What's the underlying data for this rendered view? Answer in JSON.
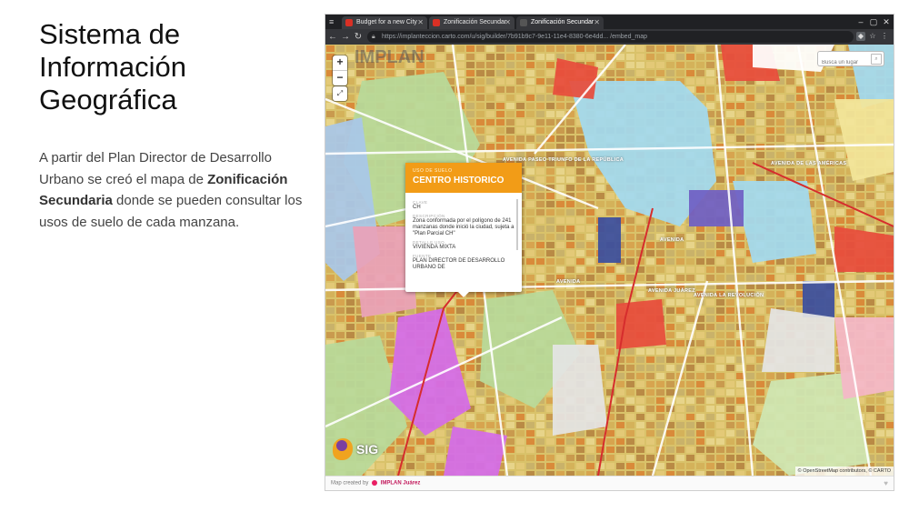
{
  "slide": {
    "title_lines": [
      "Sistema de",
      "Información",
      "Geográfica"
    ],
    "body_part1": "A partir del Plan Director de Desarrollo Urbano se creó el mapa de ",
    "body_bold": "Zonificación Secundaria",
    "body_part2": " donde se pueden consultar los usos de suelo de cada manzana."
  },
  "browser": {
    "tabs": [
      {
        "label": "Budget for a new City",
        "favicon_color": "#d93025"
      },
      {
        "label": "Zonificación Secundar",
        "favicon_color": "#d93025"
      },
      {
        "label": "Zonificación Secundar",
        "favicon_color": "#555555"
      }
    ],
    "url": "https://implanteccion.carto.com/u/sig/builder/7b91b9c7-9e11-11e4-8380-6e4dd... /embed_map",
    "icons": [
      "menu-icon",
      "back-icon",
      "forward-icon",
      "reload-icon",
      "lock-icon",
      "extensions-icon",
      "star-icon",
      "settings-icon",
      "more-icon"
    ]
  },
  "map": {
    "watermark": "IMPLAN",
    "zoom_in": "+",
    "zoom_out": "−",
    "fullscreen": "⤢",
    "search_placeholder": "Busca un lugar",
    "popup": {
      "category": "USO DE SUELO",
      "name": "CENTRO HISTORICO",
      "fields": [
        {
          "label": "CLAVE",
          "value": "CH"
        },
        {
          "label": "DESCRIPCIÓN",
          "value": "Zona conformada por el polígono de 241 manzanas donde inició la ciudad, sujeta a \"Plan Parcial CH\""
        },
        {
          "label": "DETALLE USO",
          "value": "VIVIENDA MIXTA"
        },
        {
          "label": "FUENTE",
          "value": "PLAN DIRECTOR DE DESARROLLO URBANO DE"
        }
      ]
    },
    "street_labels": [
      "AVENIDA PASEO TRIUNFO DE LA REPÚBLICA",
      "AVENIDA",
      "AVENIDA",
      "AVENIDA JUÁREZ",
      "AVENIDA DE LAS AMÉRICAS",
      "AVENIDA LA REVOLUCIÓN"
    ],
    "logo_text": "SIG",
    "attribution": "© OpenStreetMap contributors, © CARTO"
  },
  "footer": {
    "prefix": "Map created by",
    "brand": "IMPLAN Juárez"
  }
}
